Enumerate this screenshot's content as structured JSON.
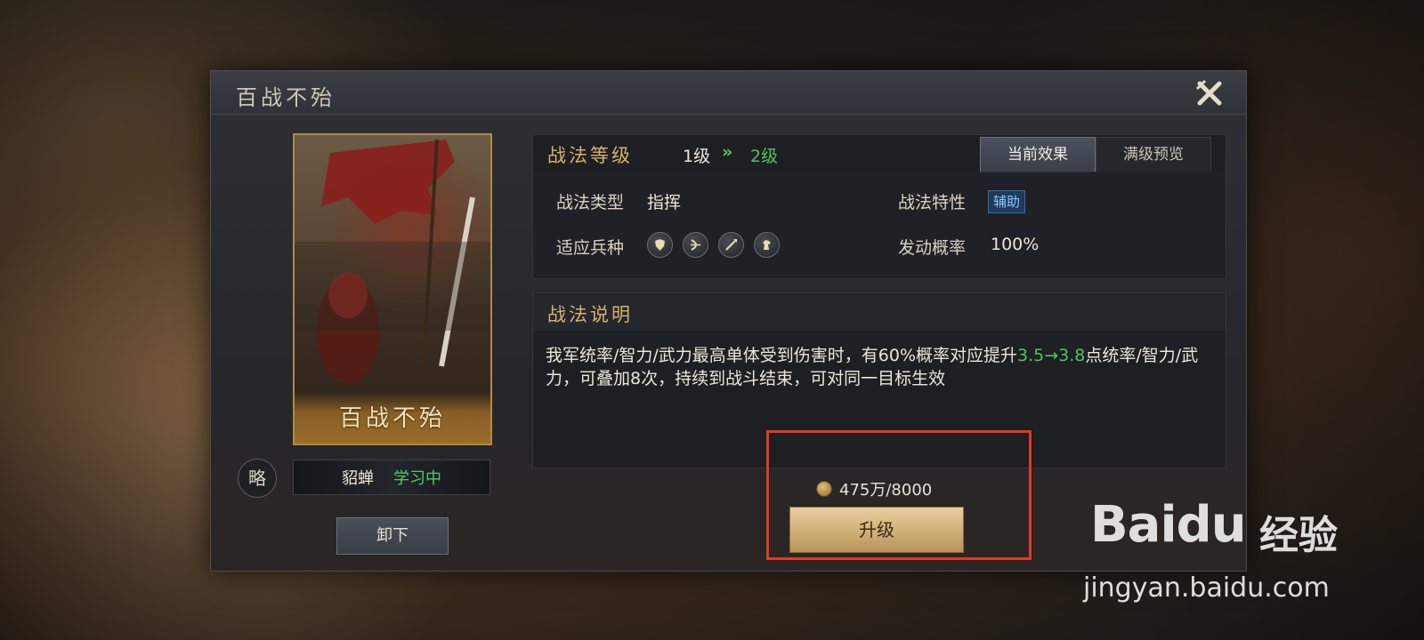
{
  "window": {
    "title": "百战不殆"
  },
  "card": {
    "name": "百战不殆",
    "type_badge": "略"
  },
  "learner": {
    "name": "貂蝉",
    "status": "学习中"
  },
  "buttons": {
    "unequip": "卸下",
    "upgrade": "升级"
  },
  "level": {
    "label": "战法等级",
    "from": "1级",
    "arrow": "»",
    "to": "2级"
  },
  "tabs": {
    "current": "当前效果",
    "max": "满级预览"
  },
  "info": {
    "type_label": "战法类型",
    "type_value": "指挥",
    "trait_label": "战法特性",
    "trait_value": "辅助",
    "troops_label": "适应兵种",
    "troops": [
      "shield-icon",
      "bow-icon",
      "spear-icon",
      "horse-icon"
    ],
    "rate_label": "发动概率",
    "rate_value": "100%"
  },
  "description": {
    "title": "战法说明",
    "text_part1": "我军统率/智力/武力最高单体受到伤害时，有60%概率对应提升",
    "highlight": "3.5→3.8",
    "text_part2": "点统率/智力/武力，可叠加8次，持续到战斗结束，可对同一目标生效"
  },
  "cost": {
    "value": "475万/8000"
  },
  "watermark": {
    "logo": "Baidu",
    "label": "经验",
    "url": "jingyan.baidu.com"
  },
  "colors": {
    "accent_gold": "#d6b26a",
    "level_green": "#4fc35f",
    "highlight_red": "#e03a24"
  }
}
